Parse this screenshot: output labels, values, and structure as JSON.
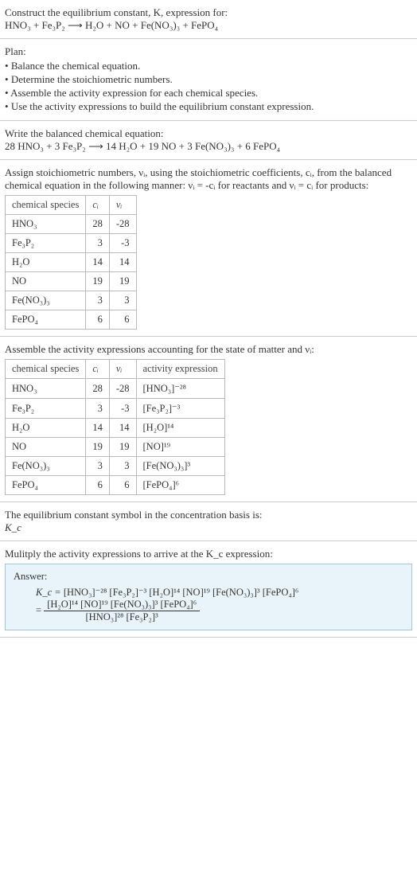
{
  "header": {
    "prompt": "Construct the equilibrium constant, K, expression for:",
    "unbalanced": "HNO₃ + Fe₃P₂ ⟶ H₂O + NO + Fe(NO₃)₃ + FePO₄"
  },
  "plan": {
    "title": "Plan:",
    "items": [
      "Balance the chemical equation.",
      "Determine the stoichiometric numbers.",
      "Assemble the activity expression for each chemical species.",
      "Use the activity expressions to build the equilibrium constant expression."
    ]
  },
  "balanced_sec": {
    "title": "Write the balanced chemical equation:",
    "equation": "28 HNO₃ + 3 Fe₃P₂ ⟶ 14 H₂O + 19 NO + 3 Fe(NO₃)₃ + 6 FePO₄"
  },
  "stoich_sec": {
    "intro": "Assign stoichiometric numbers, νᵢ, using the stoichiometric coefficients, cᵢ, from the balanced chemical equation in the following manner: νᵢ = -cᵢ for reactants and νᵢ = cᵢ for products:",
    "headers": {
      "species": "chemical species",
      "ci": "cᵢ",
      "vi": "νᵢ"
    },
    "rows": [
      {
        "species": "HNO₃",
        "ci": "28",
        "vi": "-28"
      },
      {
        "species": "Fe₃P₂",
        "ci": "3",
        "vi": "-3"
      },
      {
        "species": "H₂O",
        "ci": "14",
        "vi": "14"
      },
      {
        "species": "NO",
        "ci": "19",
        "vi": "19"
      },
      {
        "species": "Fe(NO₃)₃",
        "ci": "3",
        "vi": "3"
      },
      {
        "species": "FePO₄",
        "ci": "6",
        "vi": "6"
      }
    ]
  },
  "activity_sec": {
    "intro": "Assemble the activity expressions accounting for the state of matter and νᵢ:",
    "headers": {
      "species": "chemical species",
      "ci": "cᵢ",
      "vi": "νᵢ",
      "act": "activity expression"
    },
    "rows": [
      {
        "species": "HNO₃",
        "ci": "28",
        "vi": "-28",
        "act": "[HNO₃]⁻²⁸"
      },
      {
        "species": "Fe₃P₂",
        "ci": "3",
        "vi": "-3",
        "act": "[Fe₃P₂]⁻³"
      },
      {
        "species": "H₂O",
        "ci": "14",
        "vi": "14",
        "act": "[H₂O]¹⁴"
      },
      {
        "species": "NO",
        "ci": "19",
        "vi": "19",
        "act": "[NO]¹⁹"
      },
      {
        "species": "Fe(NO₃)₃",
        "ci": "3",
        "vi": "3",
        "act": "[Fe(NO₃)₃]³"
      },
      {
        "species": "FePO₄",
        "ci": "6",
        "vi": "6",
        "act": "[FePO₄]⁶"
      }
    ]
  },
  "symbol_sec": {
    "line1": "The equilibrium constant symbol in the concentration basis is:",
    "symbol": "K_c"
  },
  "final_sec": {
    "intro": "Mulitply the activity expressions to arrive at the K_c expression:",
    "answer_label": "Answer:",
    "kc_prefix": "K_c = ",
    "flat_expr": "[HNO₃]⁻²⁸ [Fe₃P₂]⁻³ [H₂O]¹⁴ [NO]¹⁹ [Fe(NO₃)₃]³ [FePO₄]⁶",
    "frac_num": "[H₂O]¹⁴ [NO]¹⁹ [Fe(NO₃)₃]³ [FePO₄]⁶",
    "frac_den": "[HNO₃]²⁸ [Fe₃P₂]³",
    "equals": "= "
  },
  "chart_data": {
    "type": "table",
    "tables": [
      {
        "title": "Stoichiometric numbers",
        "columns": [
          "chemical species",
          "c_i",
          "ν_i"
        ],
        "rows": [
          [
            "HNO3",
            28,
            -28
          ],
          [
            "Fe3P2",
            3,
            -3
          ],
          [
            "H2O",
            14,
            14
          ],
          [
            "NO",
            19,
            19
          ],
          [
            "Fe(NO3)3",
            3,
            3
          ],
          [
            "FePO4",
            6,
            6
          ]
        ]
      },
      {
        "title": "Activity expressions",
        "columns": [
          "chemical species",
          "c_i",
          "ν_i",
          "activity expression"
        ],
        "rows": [
          [
            "HNO3",
            28,
            -28,
            "[HNO3]^-28"
          ],
          [
            "Fe3P2",
            3,
            -3,
            "[Fe3P2]^-3"
          ],
          [
            "H2O",
            14,
            14,
            "[H2O]^14"
          ],
          [
            "NO",
            19,
            19,
            "[NO]^19"
          ],
          [
            "Fe(NO3)3",
            3,
            3,
            "[Fe(NO3)3]^3"
          ],
          [
            "FePO4",
            6,
            6,
            "[FePO4]^6"
          ]
        ]
      }
    ]
  }
}
